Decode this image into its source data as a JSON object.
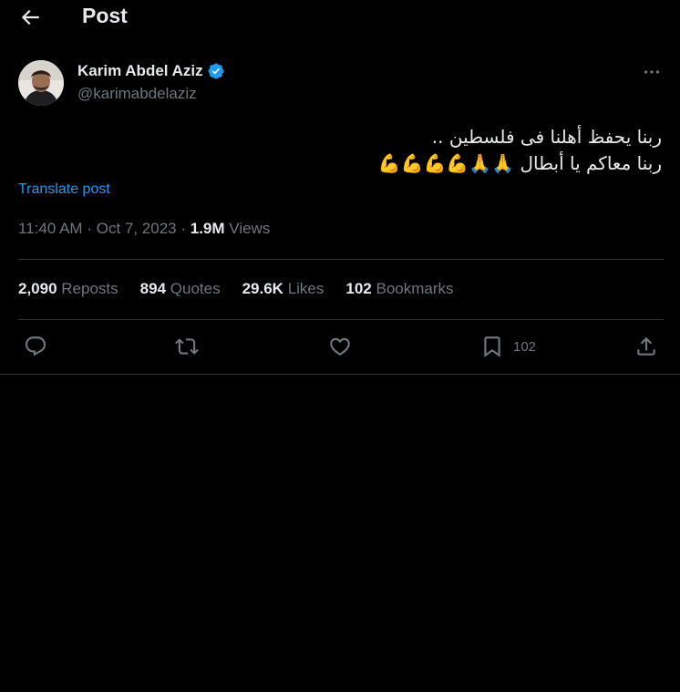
{
  "header": {
    "title": "Post"
  },
  "author": {
    "display_name": "Karim Abdel Aziz",
    "handle": "@karimabdelaziz",
    "verified": true
  },
  "tweet": {
    "line1": "ربنا يحفظ أهلنا فى فلسطين ..",
    "line2": "ربنا معاكم يا أبطال",
    "emojis": "🙏🙏💪💪💪💪",
    "translate_label": "Translate post"
  },
  "meta": {
    "time": "11:40 AM",
    "separator": "·",
    "date": "Oct 7, 2023",
    "views_count": "1.9M",
    "views_label": "Views"
  },
  "stats": {
    "reposts": {
      "count": "2,090",
      "label": "Reposts"
    },
    "quotes": {
      "count": "894",
      "label": "Quotes"
    },
    "likes": {
      "count": "29.6K",
      "label": "Likes"
    },
    "bookmarks": {
      "count": "102",
      "label": "Bookmarks"
    }
  },
  "actions": {
    "reply": "reply-icon",
    "repost": "repost-icon",
    "like": "heart-icon",
    "bookmark": "bookmark-icon",
    "bookmark_count": "102",
    "share": "share-icon"
  },
  "colors": {
    "background": "#000000",
    "text_primary": "#e7e9ea",
    "text_secondary": "#71767b",
    "accent": "#1d9bf0",
    "divider": "#2f3336"
  }
}
